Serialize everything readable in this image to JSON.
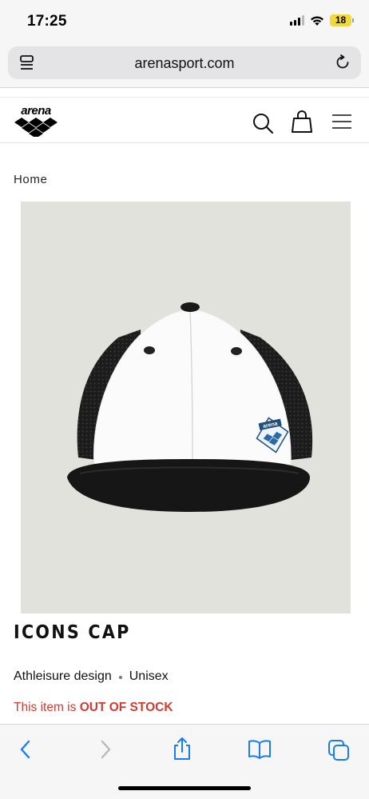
{
  "status_bar": {
    "time": "17:25",
    "battery_level": "18"
  },
  "browser": {
    "url": "arenasport.com",
    "icons": [
      "tabs-overview-icon",
      "reload-icon"
    ]
  },
  "site_header": {
    "logo_text": "arena",
    "icons": [
      "search-icon",
      "shopping-bag-icon",
      "hamburger-menu-icon"
    ]
  },
  "breadcrumb": {
    "home": "Home"
  },
  "product": {
    "title": "ICONS CAP",
    "attributes": [
      "Athleisure design",
      "Unisex"
    ],
    "stock_prefix": "This item is ",
    "stock_status": "OUT OF STOCK",
    "image_badge_text": "arena"
  },
  "toolbar": {
    "icons": [
      "back-icon",
      "forward-icon",
      "share-icon",
      "bookmarks-icon",
      "tabs-icon"
    ]
  },
  "colors": {
    "accent_blue": "#1a7cf2",
    "stock_red": "#d23b2f",
    "image_bg": "#e2e2dd",
    "battery": "#f2d93a"
  }
}
